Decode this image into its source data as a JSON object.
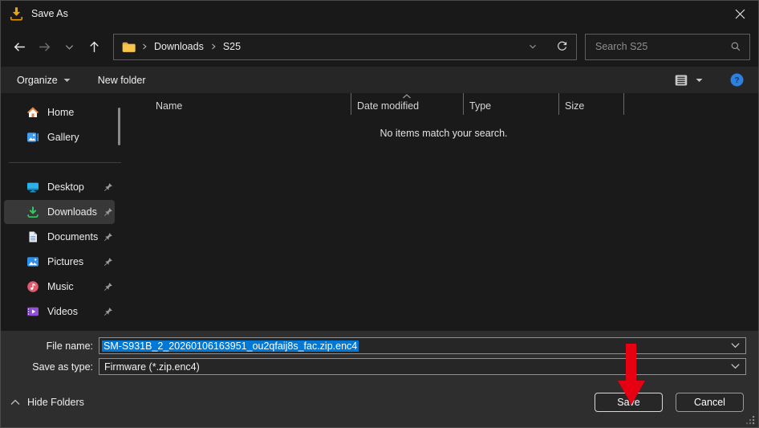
{
  "window": {
    "title": "Save As"
  },
  "navbar": {
    "breadcrumb": [
      "Downloads",
      "S25"
    ],
    "search_placeholder": "Search S25"
  },
  "toolbar": {
    "organize": "Organize",
    "new_folder": "New folder"
  },
  "sidebar": {
    "items": [
      {
        "label": "Home",
        "icon": "home-icon",
        "pinned": false,
        "selected": false
      },
      {
        "label": "Gallery",
        "icon": "gallery-icon",
        "pinned": false,
        "selected": false
      },
      {
        "label": "Desktop",
        "icon": "desktop-icon",
        "pinned": true,
        "selected": false
      },
      {
        "label": "Downloads",
        "icon": "downloads-icon",
        "pinned": true,
        "selected": true
      },
      {
        "label": "Documents",
        "icon": "documents-icon",
        "pinned": true,
        "selected": false
      },
      {
        "label": "Pictures",
        "icon": "pictures-icon",
        "pinned": true,
        "selected": false
      },
      {
        "label": "Music",
        "icon": "music-icon",
        "pinned": true,
        "selected": false
      },
      {
        "label": "Videos",
        "icon": "videos-icon",
        "pinned": true,
        "selected": false
      }
    ]
  },
  "file_list": {
    "columns": [
      "Name",
      "Date modified",
      "Type",
      "Size"
    ],
    "sort_column": "Date modified",
    "empty_message": "No items match your search."
  },
  "footer": {
    "file_name_label": "File name:",
    "file_name_value": "SM-S931B_2_20260106163951_ou2qfaij8s_fac.zip.enc4",
    "save_as_type_label": "Save as type:",
    "save_as_type_value": "Firmware (*.zip.enc4)",
    "hide_folders": "Hide Folders",
    "save": "Save",
    "cancel": "Cancel"
  },
  "colors": {
    "selection_blue": "#0078d7",
    "annotation_arrow_red": "#e60012",
    "help_blue": "#2d7fe0",
    "downloads_green": "#2fc961"
  }
}
